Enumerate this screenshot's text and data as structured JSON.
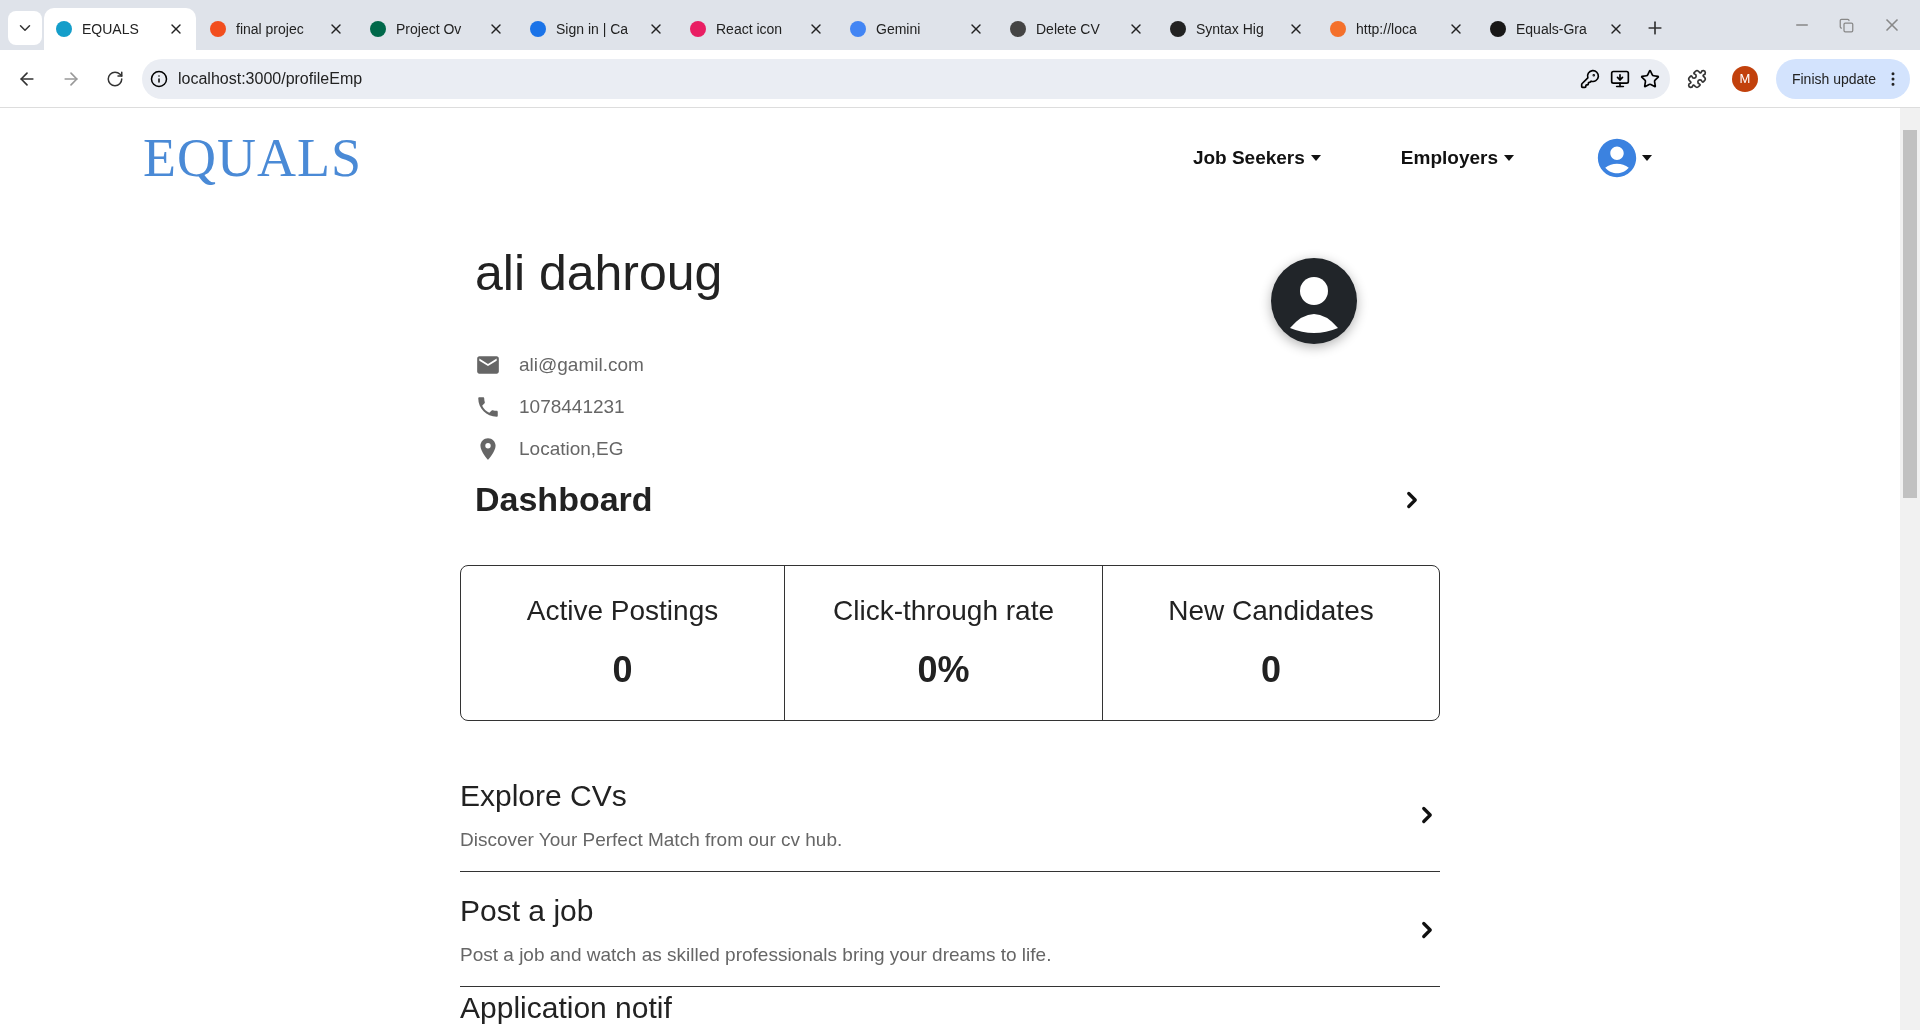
{
  "browser": {
    "tabs": [
      {
        "title": "EQUALS",
        "selected": true,
        "color": "#149eca"
      },
      {
        "title": "final projec",
        "selected": false,
        "color": "#f24e1e"
      },
      {
        "title": "Project Ov",
        "selected": false,
        "color": "#00684a"
      },
      {
        "title": "Sign in | Ca",
        "selected": false,
        "color": "#1a73e8"
      },
      {
        "title": "React icon",
        "selected": false,
        "color": "#e91e63"
      },
      {
        "title": "Gemini",
        "selected": false,
        "color": "#4285f4"
      },
      {
        "title": "Delete CV",
        "selected": false,
        "color": "#444444"
      },
      {
        "title": "Syntax Hig",
        "selected": false,
        "color": "#222222"
      },
      {
        "title": "http://loca",
        "selected": false,
        "color": "#f4702b"
      },
      {
        "title": "Equals-Gra",
        "selected": false,
        "color": "#181717"
      }
    ],
    "address": "localhost:3000/profileEmp",
    "profile_initial": "M",
    "update_button": "Finish update"
  },
  "header": {
    "logo": "EQUALS",
    "nav": [
      {
        "label": "Job Seekers"
      },
      {
        "label": "Employers"
      }
    ]
  },
  "profile": {
    "name": "ali dahroug",
    "contacts": [
      {
        "kind": "email",
        "text": "ali@gamil.com"
      },
      {
        "kind": "phone",
        "text": "1078441231"
      },
      {
        "kind": "location",
        "text": "Location,EG"
      }
    ]
  },
  "dashboard": {
    "title": "Dashboard",
    "stats": [
      {
        "label": "Active Postings",
        "value": "0"
      },
      {
        "label": "Click-through rate",
        "value": "0%"
      },
      {
        "label": "New Candidates",
        "value": "0"
      }
    ]
  },
  "actions": [
    {
      "title": "Explore CVs",
      "description": "Discover Your Perfect Match from our cv hub."
    },
    {
      "title": "Post a job",
      "description": "Post a job and watch as skilled professionals bring your dreams to life."
    },
    {
      "title": "Application notif"
    }
  ]
}
